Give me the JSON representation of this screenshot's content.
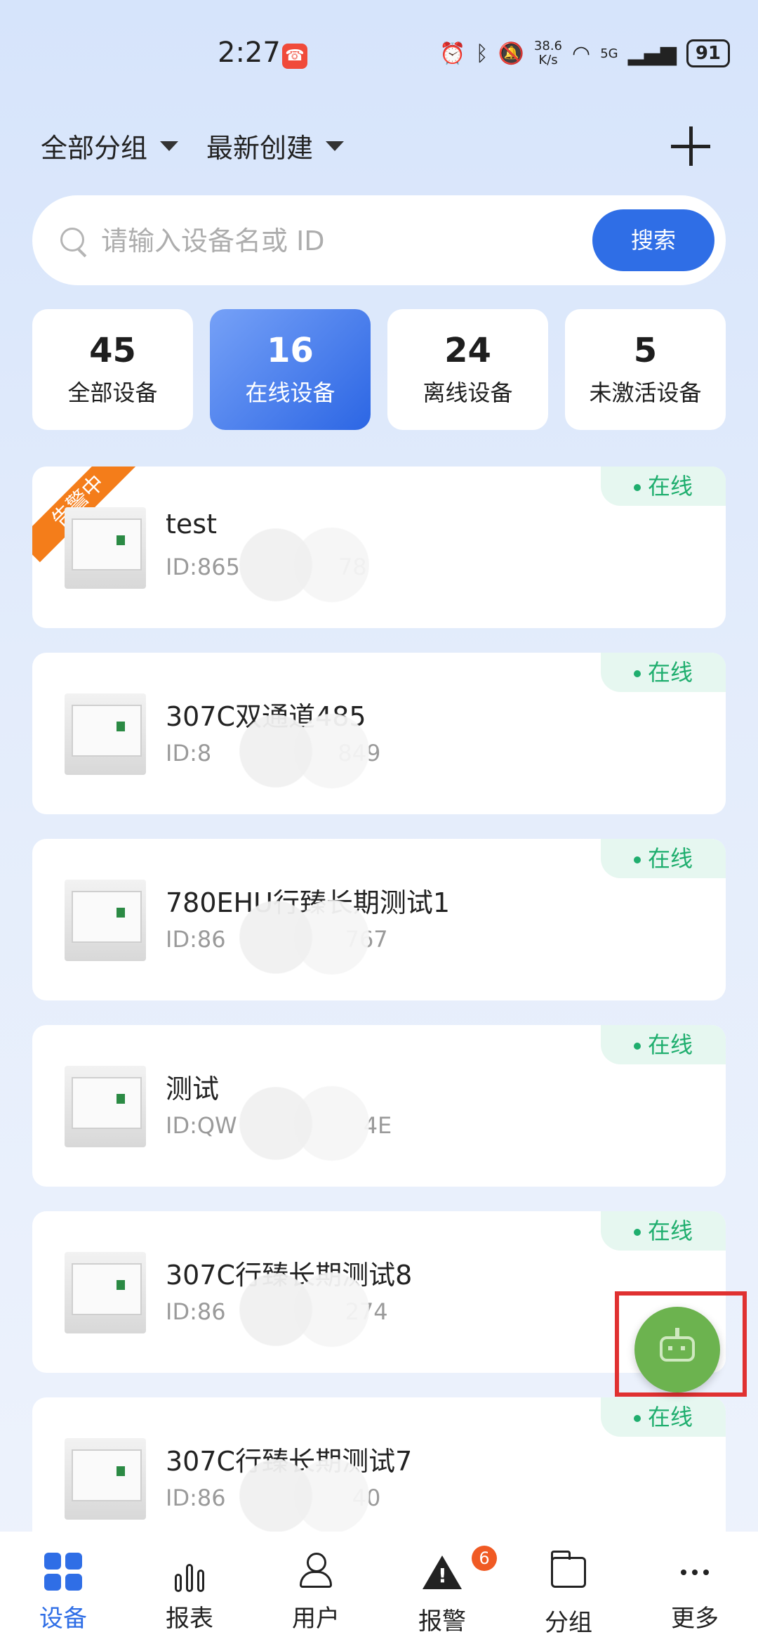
{
  "status_bar": {
    "time": "2:27",
    "speed": "38.6\nK/s",
    "speed_value": "38.6",
    "speed_unit": "K/s",
    "network": "5G",
    "battery": "91"
  },
  "filters": {
    "group_label": "全部分组",
    "sort_label": "最新创建"
  },
  "search": {
    "placeholder": "请输入设备名或 ID",
    "button_label": "搜索"
  },
  "stats": [
    {
      "value": "45",
      "label": "全部设备"
    },
    {
      "value": "16",
      "label": "在线设备"
    },
    {
      "value": "24",
      "label": "离线设备"
    },
    {
      "value": "5",
      "label": "未激活设备"
    }
  ],
  "devices": [
    {
      "name": "test",
      "id": "ID:865",
      "id_tail": "78",
      "status": "在线",
      "alarm": "告警中"
    },
    {
      "name": "307C双通道485",
      "id": "ID:8",
      "id_tail": "849",
      "status": "在线"
    },
    {
      "name": "780EHU行臻长期测试1",
      "id": "ID:86",
      "id_tail": "767",
      "status": "在线"
    },
    {
      "name": "测试",
      "id": "ID:QW",
      "id_tail": "4E",
      "status": "在线"
    },
    {
      "name": "307C行臻长期测试8",
      "id": "ID:86",
      "id_tail": "274",
      "status": "在线"
    },
    {
      "name": "307C行臻长期测试7",
      "id": "ID:86",
      "id_tail": "40",
      "status": "在线"
    }
  ],
  "bottom_nav": [
    {
      "label": "设备",
      "icon": "device-grid-icon",
      "active": true
    },
    {
      "label": "报表",
      "icon": "bar-chart-icon"
    },
    {
      "label": "用户",
      "icon": "user-icon"
    },
    {
      "label": "报警",
      "icon": "warning-icon",
      "badge": "6"
    },
    {
      "label": "分组",
      "icon": "folder-icon"
    },
    {
      "label": "更多",
      "icon": "more-icon"
    }
  ],
  "colors": {
    "accent": "#2f6ee6",
    "online": "#1fae6e",
    "alarm": "#f47d1a",
    "fab": "#6cb34f",
    "highlight_frame": "#e03131"
  }
}
